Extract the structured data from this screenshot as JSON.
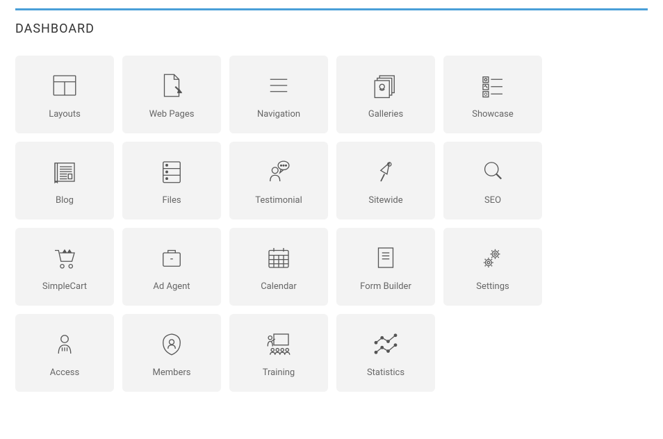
{
  "title": "DASHBOARD",
  "tiles": [
    {
      "id": "layouts",
      "label": "Layouts"
    },
    {
      "id": "web-pages",
      "label": "Web Pages"
    },
    {
      "id": "navigation",
      "label": "Navigation"
    },
    {
      "id": "galleries",
      "label": "Galleries"
    },
    {
      "id": "showcase",
      "label": "Showcase"
    },
    {
      "id": "blog",
      "label": "Blog"
    },
    {
      "id": "files",
      "label": "Files"
    },
    {
      "id": "testimonial",
      "label": "Testimonial"
    },
    {
      "id": "sitewide",
      "label": "Sitewide"
    },
    {
      "id": "seo",
      "label": "SEO"
    },
    {
      "id": "simplecart",
      "label": "SimpleCart"
    },
    {
      "id": "ad-agent",
      "label": "Ad Agent"
    },
    {
      "id": "calendar",
      "label": "Calendar"
    },
    {
      "id": "form-builder",
      "label": "Form Builder"
    },
    {
      "id": "settings",
      "label": "Settings"
    },
    {
      "id": "access",
      "label": "Access"
    },
    {
      "id": "members",
      "label": "Members"
    },
    {
      "id": "training",
      "label": "Training"
    },
    {
      "id": "statistics",
      "label": "Statistics"
    }
  ]
}
